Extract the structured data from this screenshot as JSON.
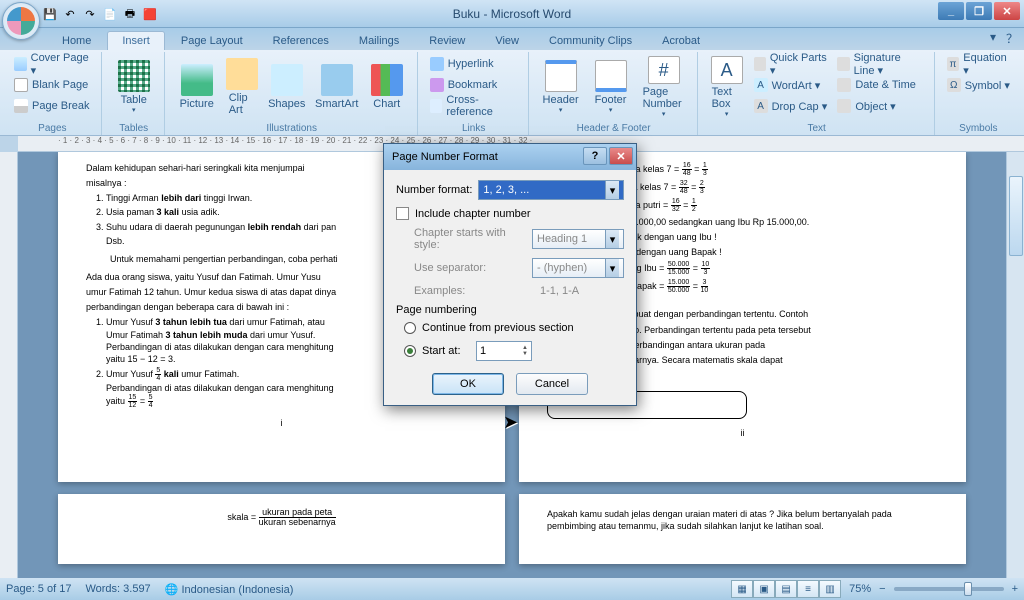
{
  "window": {
    "title": "Buku - Microsoft Word",
    "minimize": "_",
    "maximize": "❐",
    "close": "✕"
  },
  "qat": [
    "💾",
    "↶",
    "↷",
    "📄",
    "🖶",
    "🟥"
  ],
  "tabs": {
    "items": [
      "Home",
      "Insert",
      "Page Layout",
      "References",
      "Mailings",
      "Review",
      "View",
      "Community Clips",
      "Acrobat"
    ],
    "active": 1
  },
  "help": {
    "dd": "▾",
    "q": "？"
  },
  "ribbon": {
    "pages": {
      "label": "Pages",
      "cover": "Cover Page ▾",
      "blank": "Blank Page",
      "break": "Page Break"
    },
    "tables": {
      "label": "Tables",
      "table": "Table",
      "dd": "▾"
    },
    "illus": {
      "label": "Illustrations",
      "picture": "Picture",
      "clip": "Clip Art",
      "shapes": "Shapes",
      "smart": "SmartArt",
      "chart": "Chart"
    },
    "links": {
      "label": "Links",
      "hyper": "Hyperlink",
      "bmk": "Bookmark",
      "xref": "Cross-reference"
    },
    "hf": {
      "label": "Header & Footer",
      "header": "Header",
      "footer": "Footer",
      "pgnum": "Page Number",
      "dd": "▾"
    },
    "text": {
      "label": "Text",
      "txtbox": "Text Box",
      "qparts": "Quick Parts ▾",
      "wordart": "WordArt ▾",
      "dropcap": "Drop Cap ▾",
      "sigline": "Signature Line ▾",
      "datetime": "Date & Time",
      "object": "Object ▾"
    },
    "symbols": {
      "label": "Symbols",
      "eq": "Equation ▾",
      "sym": "Symbol ▾"
    }
  },
  "dialog": {
    "title": "Page Number Format",
    "number_format_label": "Number format:",
    "number_format_value": "1, 2, 3, ...",
    "include_chapter": "Include chapter number",
    "chapter_style_label": "Chapter starts with style:",
    "chapter_style_value": "Heading 1",
    "separator_label": "Use separator:",
    "separator_value": "-  (hyphen)",
    "examples_label": "Examples:",
    "examples_value": "1-1, 1-A",
    "section": "Page numbering",
    "radio_continue": "Continue from previous section",
    "radio_startat": "Start at:",
    "startat_value": "1",
    "ok": "OK",
    "cancel": "Cancel",
    "help": "?",
    "close": "✕"
  },
  "doc": {
    "left": {
      "intro": "Dalam kehidupan sehari-hari seringkali kita menjumpai",
      "misal": "misalnya :",
      "li1a": "Tinggi Arman ",
      "li1b": "lebih dari",
      "li1c": " tinggi Irwan.",
      "li2a": "Usia paman ",
      "li2b": "3 kali",
      "li2c": " usia adik.",
      "li3a": "Suhu udara di daerah pegunungan ",
      "li3b": "lebih rendah",
      "li3c": " dari pan",
      "dsb": "Dsb.",
      "para1": "Untuk memahami pengertian perbandingan, coba perhati",
      "para2": "Ada dua orang siswa, yaitu Yusuf dan Fatimah. Umur Yusu",
      "para3": "umur Fatimah 12 tahun. Umur kedua siswa di atas dapat dinya",
      "para4": "perbandingan dengan beberapa cara di bawah ini :",
      "n1a": "Umur Yusuf ",
      "n1b": "3 tahun lebih tua",
      "n1c": " dari umur Fatimah, atau",
      "n1d": "Umur Fatimah ",
      "n1e": "3 tahun lebih muda",
      "n1f": " dari umur Yusuf.",
      "n1g": "Perbandingan di atas dilakukan dengan cara menghitung",
      "n1h": "yaitu 15 − 12 = 3.",
      "n2a": "Umur Yusuf ",
      "n2b": " kali",
      "n2c": " umur Fatimah.",
      "n2d": "Perbandingan di atas dilakukan dengan cara menghitung",
      "n2e": "yaitu ",
      "f1t": "5",
      "f1b": "4",
      "f2t": "15",
      "f2b": "12",
      "f3t": "5",
      "f3b": "4",
      "pg": "i"
    },
    "right": {
      "l1": "wa putra : jumlah siswa kelas 7 = ",
      "l2": "wa putri : jumlah siswa kelas 7 = ",
      "l3": "wa putra : jumlah siswa putri = ",
      "l4": "lah uang Bapak Rp 50.000,00 sedangkan uang Ibu Rp 15.000,00.",
      "l5": "gan jumlah uang Bapak dengan uang Ibu !",
      "l6": "ngan jumlah uang Ibu dengan uang Bapak !",
      "l7": "ng Bapak : jumlah uang Ibu = ",
      "l8": "ng Ibu : jumlah uang Bapak = ",
      "p1": "rtinya gambar yang dibuat dengan perbandingan tertentu. Contoh",
      "p2": "dalah peta, denah, foto. Perbandingan tertentu pada peta tersebut",
      "p3": "a. Skala merupakan perbandingan antara ukuran pada",
      "p4": " dengan ukuran sebenarnya. Secara matematis skala dapat",
      "p5": "ai berikut :",
      "fa_t": "16",
      "fa_b": "48",
      "fa2t": "1",
      "fa2b": "3",
      "fb_t": "32",
      "fb_b": "48",
      "fb2t": "2",
      "fb2b": "3",
      "fc_t": "16",
      "fc_b": "32",
      "fc2t": "1",
      "fc2b": "2",
      "fd_t": "50.000",
      "fd_b": "15.000",
      "fd2t": "10",
      "fd2b": "3",
      "fe_t": "15.000",
      "fe_b": "50.000",
      "fe2t": "3",
      "fe2b": "10",
      "pg": "ii"
    },
    "bl": {
      "skala": "skala = ",
      "top": "ukuran pada peta",
      "bot": "ukuran sebenarnya"
    },
    "br": {
      "t1": "Apakah kamu sudah jelas dengan uraian materi di atas ? Jika belum bertanyalah pada",
      "t2": "pembimbing atau temanmu, jika sudah silahkan lanjut ke latihan soal."
    }
  },
  "statusbar": {
    "page": "Page: 5 of 17",
    "words": "Words: 3.597",
    "lang": "Indonesian (Indonesia)",
    "zoom": "75%",
    "minus": "−",
    "plus": "+"
  }
}
